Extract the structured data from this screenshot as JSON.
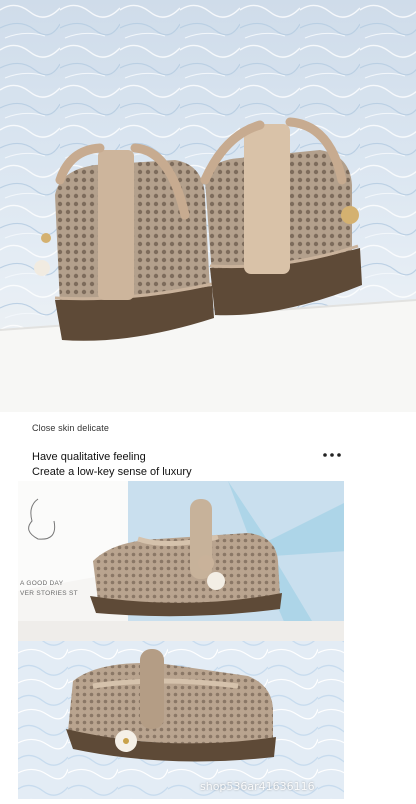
{
  "caption": "Close skin delicate",
  "headline": {
    "line1": "Have qualitative feeling",
    "line2": "Create a low-key sense of luxury"
  },
  "more_icon": "more-dots-icon",
  "box_print": {
    "line1": "A GOOD DAY",
    "line2": "VER STORIES ST"
  },
  "watermark": "shop536ar41636116",
  "colors": {
    "shoe_beige": "#b9a48f",
    "sole_brown": "#5e4a37",
    "paper_blue": "#c9d9ea",
    "ribbon_blue": "#a8d4e6"
  }
}
